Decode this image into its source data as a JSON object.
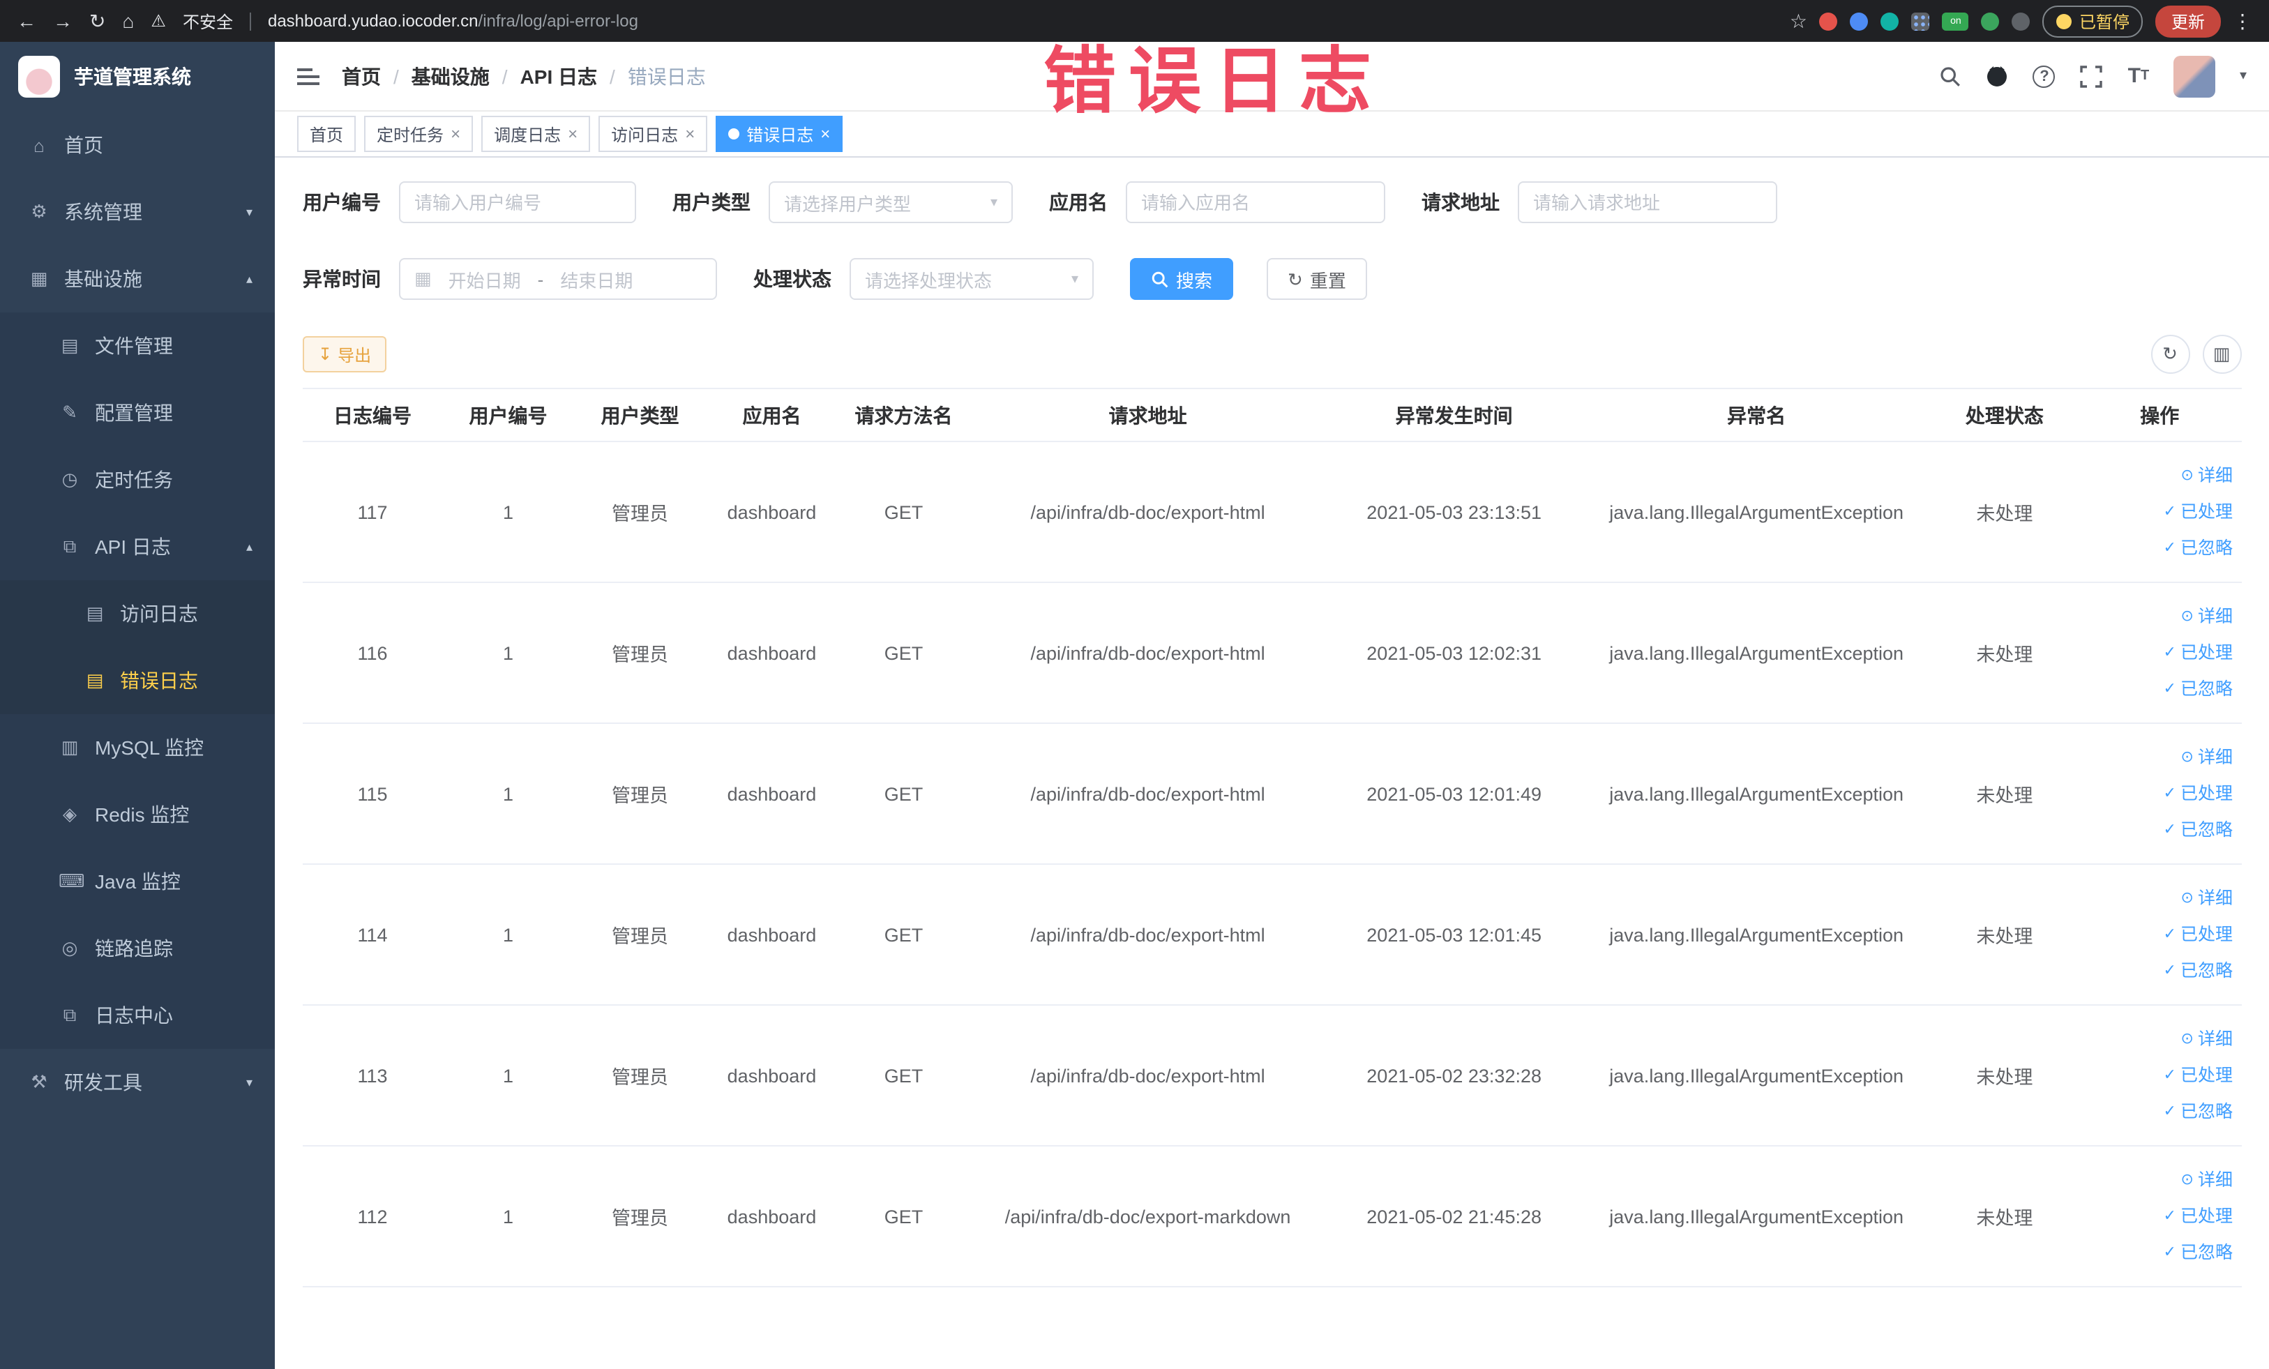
{
  "browser": {
    "security_label": "不安全",
    "url_host": "dashboard.yudao.iocoder.cn",
    "url_path": "/infra/log/api-error-log",
    "on_badge": "on",
    "paused_badge": "已暂停",
    "update_button": "更新"
  },
  "watermark": "错误日志",
  "sidebar": {
    "title": "芋道管理系统",
    "items": [
      {
        "label": "首页"
      },
      {
        "label": "系统管理"
      },
      {
        "label": "基础设施"
      },
      {
        "label": "文件管理"
      },
      {
        "label": "配置管理"
      },
      {
        "label": "定时任务"
      },
      {
        "label": "API 日志"
      },
      {
        "label": "访问日志"
      },
      {
        "label": "错误日志"
      },
      {
        "label": "MySQL 监控"
      },
      {
        "label": "Redis 监控"
      },
      {
        "label": "Java 监控"
      },
      {
        "label": "链路追踪"
      },
      {
        "label": "日志中心"
      },
      {
        "label": "研发工具"
      }
    ]
  },
  "navbar": {
    "breadcrumb": [
      "首页",
      "基础设施",
      "API 日志",
      "错误日志"
    ]
  },
  "tags": [
    {
      "label": "首页"
    },
    {
      "label": "定时任务"
    },
    {
      "label": "调度日志"
    },
    {
      "label": "访问日志"
    },
    {
      "label": "错误日志"
    }
  ],
  "filters": {
    "user_id_label": "用户编号",
    "user_id_placeholder": "请输入用户编号",
    "user_type_label": "用户类型",
    "user_type_placeholder": "请选择用户类型",
    "app_name_label": "应用名",
    "app_name_placeholder": "请输入应用名",
    "request_url_label": "请求地址",
    "request_url_placeholder": "请输入请求地址",
    "time_label": "异常时间",
    "time_start_placeholder": "开始日期",
    "time_range_separator": "-",
    "time_end_placeholder": "结束日期",
    "status_label": "处理状态",
    "status_placeholder": "请选择处理状态",
    "search_button": "搜索",
    "reset_button": "重置"
  },
  "toolbar": {
    "export_button": "导出"
  },
  "table": {
    "columns": [
      "日志编号",
      "用户编号",
      "用户类型",
      "应用名",
      "请求方法名",
      "请求地址",
      "异常发生时间",
      "异常名",
      "处理状态",
      "操作"
    ],
    "actions": {
      "detail": "详细",
      "process": "已处理",
      "ignore": "已忽略"
    },
    "rows": [
      {
        "id": "117",
        "user_id": "1",
        "user_type": "管理员",
        "app_name": "dashboard",
        "method": "GET",
        "url": "/api/infra/db-doc/export-html",
        "time": "2021-05-03 23:13:51",
        "exception": "java.lang.IllegalArgumentException",
        "status": "未处理"
      },
      {
        "id": "116",
        "user_id": "1",
        "user_type": "管理员",
        "app_name": "dashboard",
        "method": "GET",
        "url": "/api/infra/db-doc/export-html",
        "time": "2021-05-03 12:02:31",
        "exception": "java.lang.IllegalArgumentException",
        "status": "未处理"
      },
      {
        "id": "115",
        "user_id": "1",
        "user_type": "管理员",
        "app_name": "dashboard",
        "method": "GET",
        "url": "/api/infra/db-doc/export-html",
        "time": "2021-05-03 12:01:49",
        "exception": "java.lang.IllegalArgumentException",
        "status": "未处理"
      },
      {
        "id": "114",
        "user_id": "1",
        "user_type": "管理员",
        "app_name": "dashboard",
        "method": "GET",
        "url": "/api/infra/db-doc/export-html",
        "time": "2021-05-03 12:01:45",
        "exception": "java.lang.IllegalArgumentException",
        "status": "未处理"
      },
      {
        "id": "113",
        "user_id": "1",
        "user_type": "管理员",
        "app_name": "dashboard",
        "method": "GET",
        "url": "/api/infra/db-doc/export-html",
        "time": "2021-05-02 23:32:28",
        "exception": "java.lang.IllegalArgumentException",
        "status": "未处理"
      },
      {
        "id": "112",
        "user_id": "1",
        "user_type": "管理员",
        "app_name": "dashboard",
        "method": "GET",
        "url": "/api/infra/db-doc/export-markdown",
        "time": "2021-05-02 21:45:28",
        "exception": "java.lang.IllegalArgumentException",
        "status": "未处理"
      }
    ]
  }
}
